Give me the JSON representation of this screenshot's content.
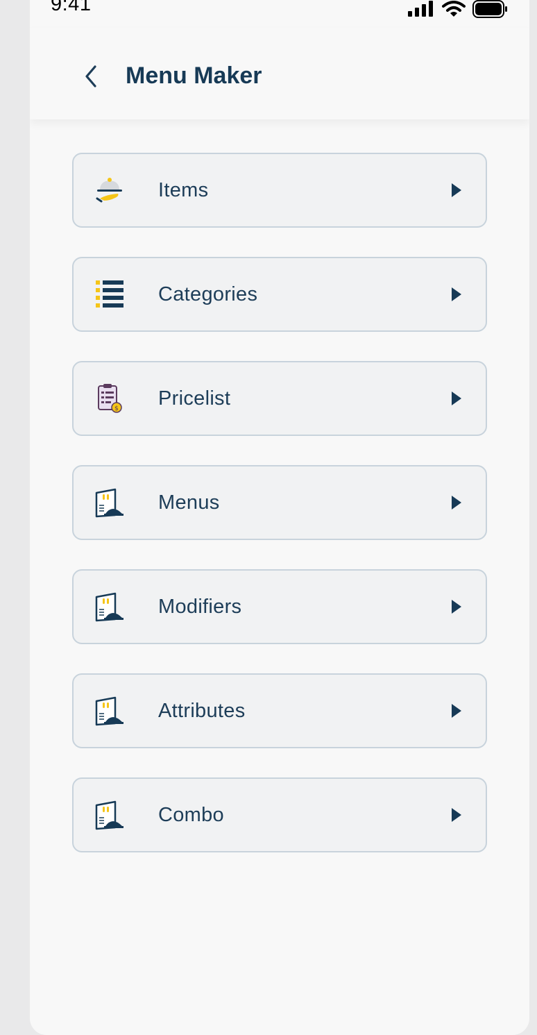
{
  "status_bar": {
    "time": "9:41",
    "icons": [
      "cellular-signal-icon",
      "wifi-icon",
      "battery-icon"
    ]
  },
  "header": {
    "back_icon": "chevron-left-icon",
    "title": "Menu Maker"
  },
  "menu": {
    "items": [
      {
        "label": "Items",
        "icon": "serving-cloche-hand-icon"
      },
      {
        "label": "Categories",
        "icon": "list-bullets-icon"
      },
      {
        "label": "Pricelist",
        "icon": "clipboard-price-icon"
      },
      {
        "label": "Menus",
        "icon": "menu-card-icon"
      },
      {
        "label": "Modifiers",
        "icon": "menu-card-icon"
      },
      {
        "label": "Attributes",
        "icon": "menu-card-icon"
      },
      {
        "label": "Combo",
        "icon": "menu-card-icon"
      }
    ],
    "arrow_icon": "caret-right-icon"
  },
  "colors": {
    "brand_navy": "#173a56",
    "accent_yellow": "#f5c518",
    "row_background": "#f1f2f3",
    "row_border": "#c8d3dc"
  }
}
